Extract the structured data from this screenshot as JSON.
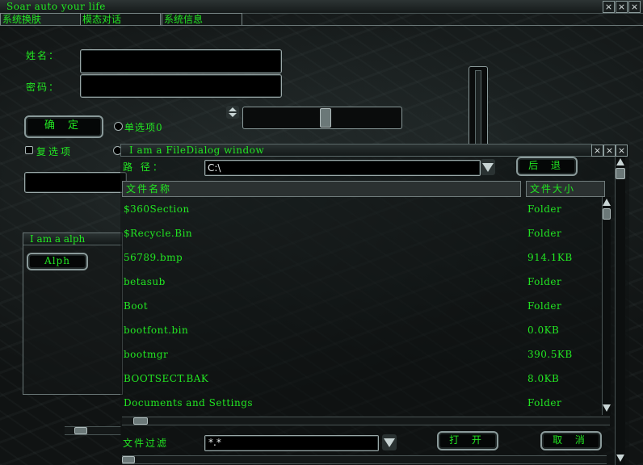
{
  "window": {
    "title": "Soar auto your life",
    "controls": [
      "⨯",
      "⨯",
      "⨯"
    ]
  },
  "tabs": [
    {
      "label": "系统换肤"
    },
    {
      "label": "模态对话"
    },
    {
      "label": "系统信息"
    }
  ],
  "form": {
    "name_label": "姓名：",
    "name_value": "",
    "password_label": "密码：",
    "password_value": "",
    "confirm_button": "确 定",
    "radio_label": "单选项0",
    "checkbox_label": "复选项"
  },
  "alpha_window": {
    "title": "I am a  alph",
    "button": "Alph"
  },
  "file_dialog": {
    "title": "I am a FileDialog window",
    "path_label": "路  径：",
    "path_value": "C:\\",
    "back_button": "后 退",
    "col_name": "文件名称",
    "col_size": "文件大小",
    "files": [
      {
        "name": "$360Section",
        "size": "Folder"
      },
      {
        "name": "$Recycle.Bin",
        "size": "Folder"
      },
      {
        "name": "56789.bmp",
        "size": "914.1KB"
      },
      {
        "name": "betasub",
        "size": "Folder"
      },
      {
        "name": "Boot",
        "size": "Folder"
      },
      {
        "name": "bootfont.bin",
        "size": "0.0KB"
      },
      {
        "name": "bootmgr",
        "size": "390.5KB"
      },
      {
        "name": "BOOTSECT.BAK",
        "size": "8.0KB"
      },
      {
        "name": "Documents and Settings",
        "size": "Folder"
      }
    ],
    "filter_label": "文件过滤",
    "filter_value": "*.*",
    "open_button": "打 开",
    "cancel_button": "取 消"
  }
}
